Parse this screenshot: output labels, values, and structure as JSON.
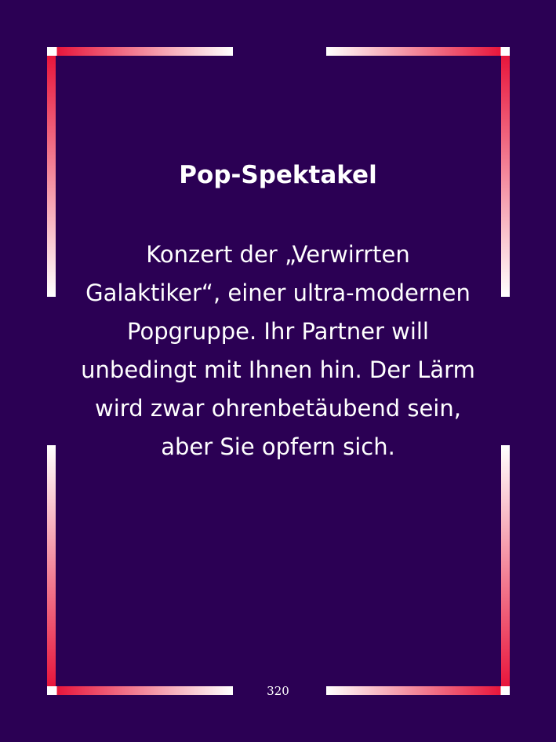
{
  "card": {
    "title": "Pop-Spektakel",
    "text": "Konzert der „Verwirrten Galaktiker“, einer ultra-modernen Popgruppe. Ihr Partner will unbedingt mit Ihnen hin. Der Lärm wird zwar ohrenbetäubend sein, aber Sie opfern sich.",
    "page_number": "320"
  },
  "colors": {
    "background": "#2b0054",
    "frame_accent": "#e8163c",
    "frame_light": "#ffffff",
    "text": "#ffffff"
  }
}
